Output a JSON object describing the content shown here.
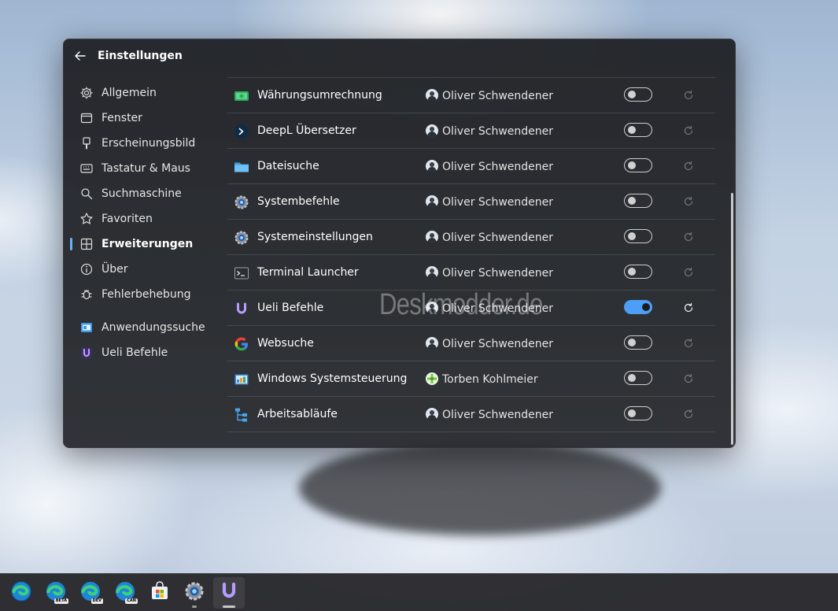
{
  "window": {
    "title": "Einstellungen"
  },
  "sidebar": {
    "items": [
      {
        "label": "Allgemein",
        "icon": "gear-icon"
      },
      {
        "label": "Fenster",
        "icon": "window-icon"
      },
      {
        "label": "Erscheinungsbild",
        "icon": "brush-icon"
      },
      {
        "label": "Tastatur & Maus",
        "icon": "keyboard-icon"
      },
      {
        "label": "Suchmaschine",
        "icon": "search-icon"
      },
      {
        "label": "Favoriten",
        "icon": "star-icon"
      },
      {
        "label": "Erweiterungen",
        "icon": "extensions-icon",
        "active": true
      },
      {
        "label": "Über",
        "icon": "info-icon"
      },
      {
        "label": "Fehlerbehebung",
        "icon": "bug-icon"
      }
    ],
    "extension_items": [
      {
        "label": "Anwendungssuche",
        "icon": "app-search-icon"
      },
      {
        "label": "Ueli Befehle",
        "icon": "ueli-icon"
      }
    ]
  },
  "extensions": [
    {
      "name": "Währungsumrechnung",
      "author": "Oliver Schwendener",
      "enabled": false,
      "icon": "currency-icon"
    },
    {
      "name": "DeepL Übersetzer",
      "author": "Oliver Schwendener",
      "enabled": false,
      "icon": "deepl-icon"
    },
    {
      "name": "Dateisuche",
      "author": "Oliver Schwendener",
      "enabled": false,
      "icon": "folder-icon"
    },
    {
      "name": "Systembefehle",
      "author": "Oliver Schwendener",
      "enabled": false,
      "icon": "system-gear-icon"
    },
    {
      "name": "Systemeinstellungen",
      "author": "Oliver Schwendener",
      "enabled": false,
      "icon": "settings-icon"
    },
    {
      "name": "Terminal Launcher",
      "author": "Oliver Schwendener",
      "enabled": false,
      "icon": "terminal-icon"
    },
    {
      "name": "Ueli Befehle",
      "author": "Oliver Schwendener",
      "enabled": true,
      "icon": "ueli-icon"
    },
    {
      "name": "Websuche",
      "author": "Oliver Schwendener",
      "enabled": false,
      "icon": "google-icon"
    },
    {
      "name": "Windows Systemsteuerung",
      "author": "Torben Kohlmeier",
      "enabled": false,
      "icon": "control-panel-icon"
    },
    {
      "name": "Arbeitsabläufe",
      "author": "Oliver Schwendener",
      "enabled": false,
      "icon": "workflow-icon"
    }
  ],
  "watermark": "Deskmodder.de",
  "taskbar": {
    "apps": [
      {
        "name": "edge-icon",
        "badge": ""
      },
      {
        "name": "edge-beta-icon",
        "badge": "BETA"
      },
      {
        "name": "edge-dev-icon",
        "badge": "DEV"
      },
      {
        "name": "edge-canary-icon",
        "badge": "CAN"
      },
      {
        "name": "store-icon",
        "badge": ""
      },
      {
        "name": "settings-app-icon",
        "badge": ""
      },
      {
        "name": "ueli-app-icon",
        "badge": ""
      }
    ]
  },
  "colors": {
    "accent": "#4d9ff5",
    "window_bg": "#232529"
  }
}
